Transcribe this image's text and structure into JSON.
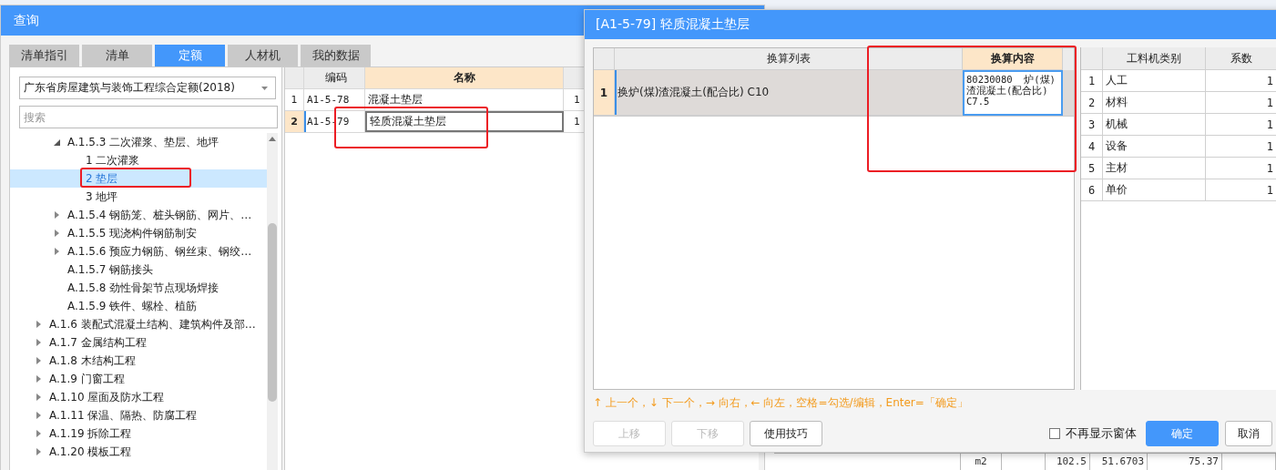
{
  "background_table": {
    "cells": [
      "m2",
      "102.5",
      "51.6703",
      "75.37"
    ]
  },
  "query_dialog": {
    "title": "查询",
    "tabs": [
      {
        "label": "清单指引",
        "selected": false
      },
      {
        "label": "清单",
        "selected": false
      },
      {
        "label": "定额",
        "selected": true
      },
      {
        "label": "人材机",
        "selected": false
      },
      {
        "label": "我的数据",
        "selected": false
      }
    ],
    "library": {
      "value": "广东省房屋建筑与装饰工程综合定额(2018)"
    },
    "search": {
      "placeholder": "搜索"
    },
    "tree": [
      {
        "children": [
          {
            "label": "A.1.5.3 二次灌浆、垫层、地坪",
            "expanded": true,
            "children": [
              {
                "label": "1 二次灌浆",
                "selected": false
              },
              {
                "label": "2 垫层",
                "selected": true
              },
              {
                "label": "3 地坪",
                "selected": false
              }
            ]
          },
          {
            "label": "A.1.5.4 钢筋笼、桩头钢筋、网片、…",
            "expanded": false
          },
          {
            "label": "A.1.5.5 现浇构件钢筋制安",
            "expanded": false
          },
          {
            "label": "A.1.5.6 预应力钢筋、钢丝束、钢绞…",
            "expanded": false
          },
          {
            "label": "A.1.5.7 钢筋接头",
            "selected": false
          },
          {
            "label": "A.1.5.8 劲性骨架节点现场焊接",
            "selected": false
          },
          {
            "label": "A.1.5.9 铁件、螺栓、植筋",
            "selected": false
          }
        ]
      },
      {
        "label": "A.1.6 装配式混凝土结构、建筑构件及部…",
        "expanded": false
      },
      {
        "label": "A.1.7 金属结构工程",
        "expanded": false
      },
      {
        "label": "A.1.8 木结构工程",
        "expanded": false
      },
      {
        "label": "A.1.9 门窗工程",
        "expanded": false
      },
      {
        "label": "A.1.10 屋面及防水工程",
        "expanded": false
      },
      {
        "label": "A.1.11 保温、隔热、防腐工程",
        "expanded": false
      },
      {
        "label": "A.1.19 拆除工程",
        "expanded": false
      },
      {
        "label": "A.1.20 模板工程",
        "expanded": false
      }
    ],
    "table": {
      "columns": [
        "编码",
        "名称"
      ],
      "rows": [
        {
          "index": "1",
          "code": "A1-5-78",
          "name": "混凝土垫层",
          "column_3": "1",
          "selected": false
        },
        {
          "index": "2",
          "code": "A1-5-79",
          "name": "轻质混凝土垫层",
          "column_3": "1",
          "selected": true
        }
      ]
    }
  },
  "conversion_dialog": {
    "title": "[A1-5-79] 轻质混凝土垫层",
    "conversion_table": {
      "columns": [
        "换算列表",
        "换算内容"
      ],
      "rows": [
        {
          "index": "1",
          "item": "换炉(煤)渣混凝土(配合比) C10",
          "content": "80230080  炉(煤)渣混凝土(配合比) C7.5",
          "selected": true
        }
      ]
    },
    "factor_table": {
      "columns": [
        "工料机类别",
        "系数"
      ],
      "rows": [
        {
          "index": "1",
          "category": "人工",
          "factor": "1"
        },
        {
          "index": "2",
          "category": "材料",
          "factor": "1"
        },
        {
          "index": "3",
          "category": "机械",
          "factor": "1"
        },
        {
          "index": "4",
          "category": "设备",
          "factor": "1"
        },
        {
          "index": "5",
          "category": "主材",
          "factor": "1"
        },
        {
          "index": "6",
          "category": "单价",
          "factor": "1"
        }
      ]
    },
    "hint": "↑ 上一个，↓ 下一个，→ 向右，← 向左，空格=勾选/编辑，Enter=「确定」",
    "left_buttons": [
      {
        "label": "上移",
        "disabled": true
      },
      {
        "label": "下移",
        "disabled": true
      },
      {
        "label": "使用技巧",
        "disabled": false
      }
    ],
    "dont_show_again": {
      "label": "不再显示窗体",
      "checked": false
    },
    "right_buttons": [
      {
        "label": "确定",
        "kind": "primary"
      },
      {
        "label": "取消",
        "kind": "default"
      }
    ]
  }
}
